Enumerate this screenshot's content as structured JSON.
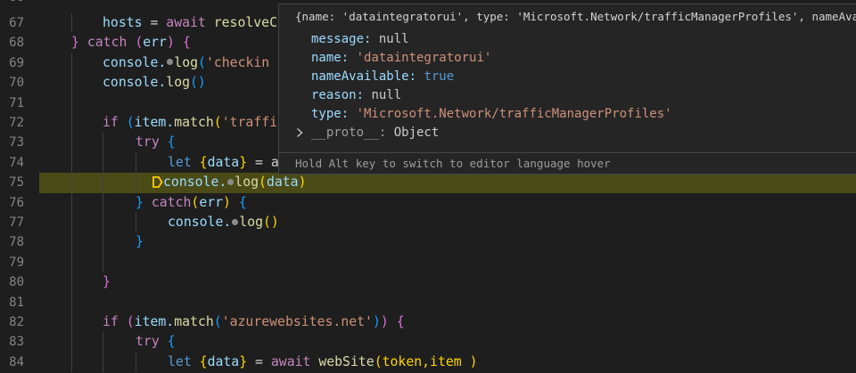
{
  "editor": {
    "top_partial_line": "66",
    "lines": [
      {
        "num": "67"
      },
      {
        "num": "68"
      },
      {
        "num": "69"
      },
      {
        "num": "70"
      },
      {
        "num": "71"
      },
      {
        "num": "72"
      },
      {
        "num": "73"
      },
      {
        "num": "74"
      },
      {
        "num": "75"
      },
      {
        "num": "76"
      },
      {
        "num": "77"
      },
      {
        "num": "78"
      },
      {
        "num": "79"
      },
      {
        "num": "80"
      },
      {
        "num": "81"
      },
      {
        "num": "82"
      },
      {
        "num": "83"
      },
      {
        "num": "84"
      }
    ],
    "code": {
      "l67_hosts": "hosts",
      "l67_eq": " = ",
      "l67_await": "await",
      "l67_fn": " resolveC",
      "l68_brace": "}",
      "l68_catch": "catch",
      "l68_open": "(",
      "l68_err": "err",
      "l68_close": ")",
      "l68_lbrace": "{",
      "l69_console": "console.",
      "l69_log": "log",
      "l69_paren": "(",
      "l69_str": "'checkin",
      "l70_console": "console.",
      "l70_log": "log",
      "l70_parens": "()",
      "l72_if": "if",
      "l72_open": "(",
      "l72_item": "item.",
      "l72_match": "match",
      "l72_paren": "(",
      "l72_str": "'traffi",
      "l73_try": "try",
      "l73_brace": "{",
      "l74_let": "let",
      "l74_brace": "{",
      "l74_data": "data",
      "l74_close": "}",
      "l74_eq": " = a",
      "l75_console": "console.",
      "l75_log": "log",
      "l75_open": "(",
      "l75_data": "data",
      "l75_close": ")",
      "l76_brace": "}",
      "l76_catch": "catch",
      "l76_open": "(",
      "l76_err": "err",
      "l76_close": ")",
      "l76_lbrace": "{",
      "l77_console": "console.",
      "l77_log": "log",
      "l77_parens": "()",
      "l78_brace": "}",
      "l80_brace": "}",
      "l82_if": "if",
      "l82_open": "(",
      "l82_item": "item.",
      "l82_match": "match",
      "l82_paren": "(",
      "l82_str": "'azurewebsites.net'",
      "l82_close1": ")",
      "l82_close2": ")",
      "l82_lbrace": "{",
      "l83_try": "try",
      "l83_brace": "{",
      "l84_let": "let",
      "l84_brace": "{",
      "l84_data": "data",
      "l84_close": "}",
      "l84_eq": " = ",
      "l84_await": "await",
      "l84_fn": " webSite",
      "l84_args": "(token,item )"
    },
    "colors": {
      "background": "#1e1e1e",
      "current_line": "#4b4b18",
      "keyword": "#c586c0",
      "variable": "#9cdcfe",
      "function": "#dcdcaa",
      "string": "#ce9178"
    }
  },
  "hover": {
    "header": "{name: 'dataintegratorui', type: 'Microsoft.Network/trafficManagerProfiles', nameAvaila…",
    "properties": [
      {
        "key": "message",
        "value": "null"
      },
      {
        "key": "name",
        "value": "'dataintegratorui'"
      },
      {
        "key": "nameAvailable",
        "value": "true"
      },
      {
        "key": "reason",
        "value": "null"
      },
      {
        "key": "type",
        "value": "'Microsoft.Network/trafficManagerProfiles'"
      }
    ],
    "proto_key": "__proto__",
    "proto_value": "Object",
    "footer": "Hold Alt key to switch to editor language hover"
  }
}
